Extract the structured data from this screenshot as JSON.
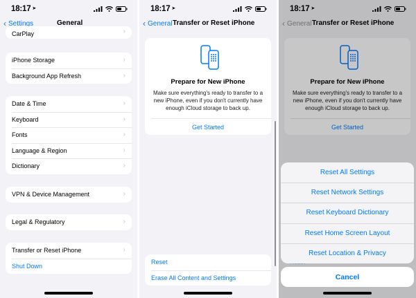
{
  "status_bar": {
    "time": "18:17"
  },
  "panel1": {
    "nav": {
      "back_label": "Settings",
      "title": "General"
    },
    "groups": [
      {
        "rows": [
          {
            "label": "CarPlay"
          }
        ]
      },
      {
        "rows": [
          {
            "label": "iPhone Storage"
          },
          {
            "label": "Background App Refresh"
          }
        ]
      },
      {
        "rows": [
          {
            "label": "Date & Time"
          },
          {
            "label": "Keyboard"
          },
          {
            "label": "Fonts"
          },
          {
            "label": "Language & Region"
          },
          {
            "label": "Dictionary"
          }
        ]
      },
      {
        "rows": [
          {
            "label": "VPN & Device Management"
          }
        ]
      },
      {
        "rows": [
          {
            "label": "Legal & Regulatory"
          }
        ]
      },
      {
        "rows": [
          {
            "label": "Transfer or Reset iPhone"
          },
          {
            "label": "Shut Down"
          }
        ]
      }
    ]
  },
  "panel2": {
    "nav": {
      "back_label": "General",
      "title": "Transfer or Reset iPhone"
    },
    "card": {
      "title": "Prepare for New iPhone",
      "description": "Make sure everything's ready to transfer to a new iPhone, even if you don't currently have enough iCloud storage to back up.",
      "action": "Get Started"
    },
    "reset_group": [
      {
        "label": "Reset"
      },
      {
        "label": "Erase All Content and Settings"
      }
    ]
  },
  "panel3": {
    "nav": {
      "back_label": "General",
      "title": "Transfer or Reset iPhone"
    },
    "card": {
      "title": "Prepare for New iPhone",
      "description": "Make sure everything's ready to transfer to a new iPhone, even if you don't currently have enough iCloud storage to back up.",
      "action": "Get Started"
    },
    "peek_label": "Reset",
    "sheet": {
      "options": [
        {
          "label": "Reset All Settings"
        },
        {
          "label": "Reset Network Settings"
        },
        {
          "label": "Reset Keyboard Dictionary"
        },
        {
          "label": "Reset Home Screen Layout"
        },
        {
          "label": "Reset Location & Privacy"
        }
      ],
      "cancel": "Cancel"
    }
  },
  "colors": {
    "accent": "#007aff",
    "background": "#f2f2f7",
    "chevron": "#c4c4c7"
  }
}
